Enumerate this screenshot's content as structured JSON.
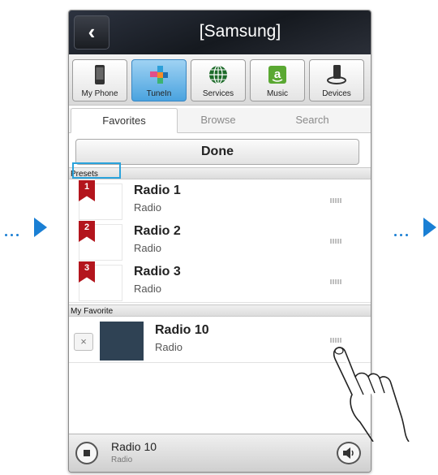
{
  "header": {
    "title": "[Samsung]"
  },
  "sources": [
    {
      "label": "My Phone",
      "icon": "phone-icon"
    },
    {
      "label": "TuneIn",
      "icon": "tunein-icon"
    },
    {
      "label": "Services",
      "icon": "globe-icon"
    },
    {
      "label": "Music",
      "icon": "amazon-icon"
    },
    {
      "label": "Devices",
      "icon": "devices-icon"
    }
  ],
  "tabs": [
    {
      "label": "Favorites",
      "active": true
    },
    {
      "label": "Browse"
    },
    {
      "label": "Search"
    }
  ],
  "done_label": "Done",
  "sections": {
    "presets": "Presets",
    "favorites": "My Favorite"
  },
  "presets": [
    {
      "num": "1",
      "title": "Radio 1",
      "subtitle": "Radio"
    },
    {
      "num": "2",
      "title": "Radio 2",
      "subtitle": "Radio"
    },
    {
      "num": "3",
      "title": "Radio 3",
      "subtitle": "Radio"
    }
  ],
  "favorite": {
    "delete_label": "×",
    "title": "Radio 10",
    "subtitle": "Radio"
  },
  "now_playing": {
    "title": "Radio 10",
    "subtitle": "Radio"
  },
  "colors": {
    "accent": "#1a7fd4",
    "ribbon": "#b3151d",
    "tab_active": "#4aa3df"
  }
}
